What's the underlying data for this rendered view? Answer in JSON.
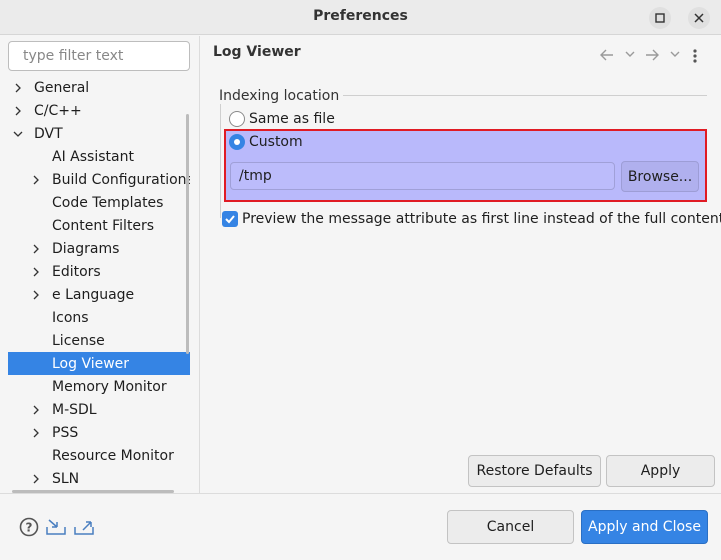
{
  "window": {
    "title": "Preferences"
  },
  "filter": {
    "placeholder": "type filter text"
  },
  "tree": [
    {
      "label": "General",
      "level": 0,
      "expandable": true,
      "expanded": false
    },
    {
      "label": "C/C++",
      "level": 0,
      "expandable": true,
      "expanded": false
    },
    {
      "label": "DVT",
      "level": 0,
      "expandable": true,
      "expanded": true
    },
    {
      "label": "AI Assistant",
      "level": 1,
      "expandable": false
    },
    {
      "label": "Build Configurations",
      "level": 1,
      "expandable": true,
      "expanded": false
    },
    {
      "label": "Code Templates",
      "level": 1,
      "expandable": false
    },
    {
      "label": "Content Filters",
      "level": 1,
      "expandable": false
    },
    {
      "label": "Diagrams",
      "level": 1,
      "expandable": true,
      "expanded": false
    },
    {
      "label": "Editors",
      "level": 1,
      "expandable": true,
      "expanded": false
    },
    {
      "label": "e Language",
      "level": 1,
      "expandable": true,
      "expanded": false
    },
    {
      "label": "Icons",
      "level": 1,
      "expandable": false
    },
    {
      "label": "License",
      "level": 1,
      "expandable": false
    },
    {
      "label": "Log Viewer",
      "level": 1,
      "expandable": false,
      "selected": true
    },
    {
      "label": "Memory Monitor",
      "level": 1,
      "expandable": false
    },
    {
      "label": "M-SDL",
      "level": 1,
      "expandable": true,
      "expanded": false
    },
    {
      "label": "PSS",
      "level": 1,
      "expandable": true,
      "expanded": false
    },
    {
      "label": "Resource Monitor",
      "level": 1,
      "expandable": false
    },
    {
      "label": "SLN",
      "level": 1,
      "expandable": true,
      "expanded": false
    }
  ],
  "page": {
    "title": "Log Viewer",
    "indexing_group_label": "Indexing location",
    "radio_same_as_file": "Same as file",
    "radio_custom": "Custom",
    "selected_option": "Custom",
    "path_value": "/tmp",
    "browse_label": "Browse...",
    "preview_label": "Preview the message attribute as first line instead of the full content",
    "preview_checked": true
  },
  "buttons": {
    "restore_defaults": "Restore Defaults",
    "apply": "Apply",
    "cancel": "Cancel",
    "apply_and_close": "Apply and Close"
  },
  "icons": {
    "back": "back-arrow-icon",
    "forward": "forward-arrow-icon",
    "menu": "vertical-dots-icon",
    "help": "help-icon",
    "import": "import-icon",
    "export": "export-icon"
  },
  "colors": {
    "accent": "#3584e4",
    "highlight_fill": "#b9b9fb",
    "highlight_border": "#e01b24"
  }
}
